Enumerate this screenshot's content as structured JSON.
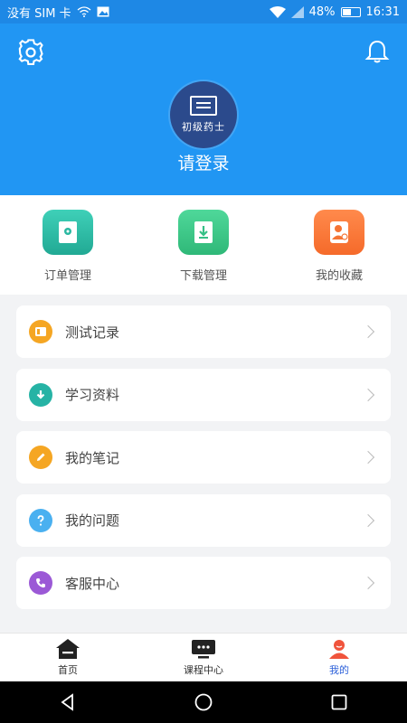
{
  "status_bar": {
    "carrier": "没有 SIM 卡",
    "battery": "48%",
    "time": "16:31"
  },
  "header": {
    "avatar_text": "初级药士",
    "login_text": "请登录"
  },
  "quick_actions": [
    {
      "label": "订单管理",
      "icon": "order-icon",
      "color": "#2dbfa8"
    },
    {
      "label": "下载管理",
      "icon": "download-icon",
      "color": "#3cc98a"
    },
    {
      "label": "我的收藏",
      "icon": "favorite-user-icon",
      "color": "#ff7a3d"
    }
  ],
  "menu": [
    {
      "label": "测试记录",
      "icon": "test-record-icon",
      "color": "#f5a623"
    },
    {
      "label": "学习资料",
      "icon": "study-download-icon",
      "color": "#26b3a5"
    },
    {
      "label": "我的笔记",
      "icon": "pencil-icon",
      "color": "#f5a623"
    },
    {
      "label": "我的问题",
      "icon": "question-icon",
      "color": "#4ab0f0"
    },
    {
      "label": "客服中心",
      "icon": "phone-icon",
      "color": "#9b59d6"
    }
  ],
  "tabs": [
    {
      "label": "首页",
      "icon": "home-icon"
    },
    {
      "label": "课程中心",
      "icon": "course-icon"
    },
    {
      "label": "我的",
      "icon": "profile-icon"
    }
  ],
  "active_tab": "我的",
  "accent_color": "#2196f3"
}
